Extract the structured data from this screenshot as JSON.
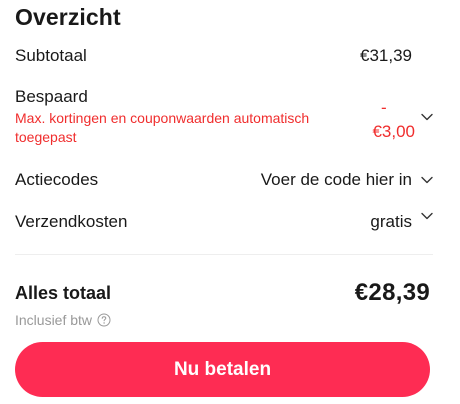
{
  "overview": {
    "title": "Overzicht",
    "subtotal": {
      "label": "Subtotaal",
      "value": "€31,39"
    },
    "saved": {
      "label": "Bespaard",
      "note": "Max. kortingen en couponwaarden automatisch toegepast",
      "value_sign": "-",
      "value": "€3,00"
    },
    "promo_codes": {
      "label": "Actiecodes",
      "value": "Voer de code hier in"
    },
    "shipping": {
      "label": "Verzendkosten",
      "value": "gratis"
    },
    "total": {
      "label": "Alles totaal",
      "value": "€28,39"
    },
    "tax_note": "Inclusief btw",
    "pay_button": "Nu betalen"
  },
  "icons": {
    "chevron": "chevron-down-icon",
    "help": "question-circle-icon"
  },
  "colors": {
    "accent": "#fe2c53",
    "discount": "#f02d2d",
    "muted": "#999999",
    "text": "#191919"
  }
}
